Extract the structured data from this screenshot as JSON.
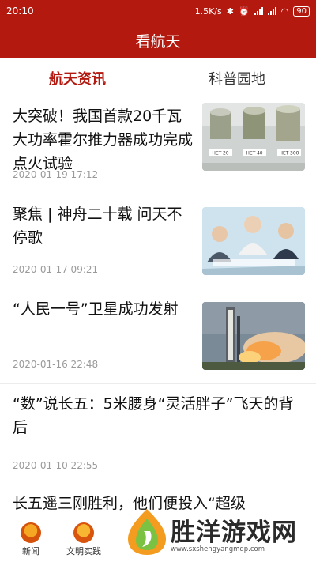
{
  "status": {
    "time": "20:10",
    "speed": "1.5K/s",
    "battery": "90"
  },
  "appbar": {
    "title": "看航天"
  },
  "tabs": [
    {
      "label": "航天资讯",
      "active": true
    },
    {
      "label": "科普园地",
      "active": false
    }
  ],
  "articles": [
    {
      "title": "大突破！我国首款20千瓦大功率霍尔推力器成功完成点火试验",
      "date": "2020-01-19 17:12",
      "thumb_labels": [
        "HET-20",
        "HET-40",
        "HET-300"
      ]
    },
    {
      "title": "聚焦 | 神舟二十载 问天不停歌",
      "date": "2020-01-17 09:21"
    },
    {
      "title": "“人民一号”卫星成功发射",
      "date": "2020-01-16 22:48"
    },
    {
      "title": "“数”说长五：5米腰身“灵活胖子”飞天的背后",
      "date": "2020-01-10 22:55"
    },
    {
      "title": "长五遥三刚胜利，他们便投入“超级"
    }
  ],
  "bottom_nav": [
    {
      "label": "新闻",
      "icon": "news-icon"
    },
    {
      "label": "文明实践",
      "icon": "civilization-practice-icon"
    }
  ],
  "watermark": {
    "text": "胜洋游戏网",
    "url": "www.sxshengyangmdp.com"
  },
  "colors": {
    "brand": "#b3190f",
    "active_tab": "#b3190f",
    "date": "#9a9a9a"
  }
}
